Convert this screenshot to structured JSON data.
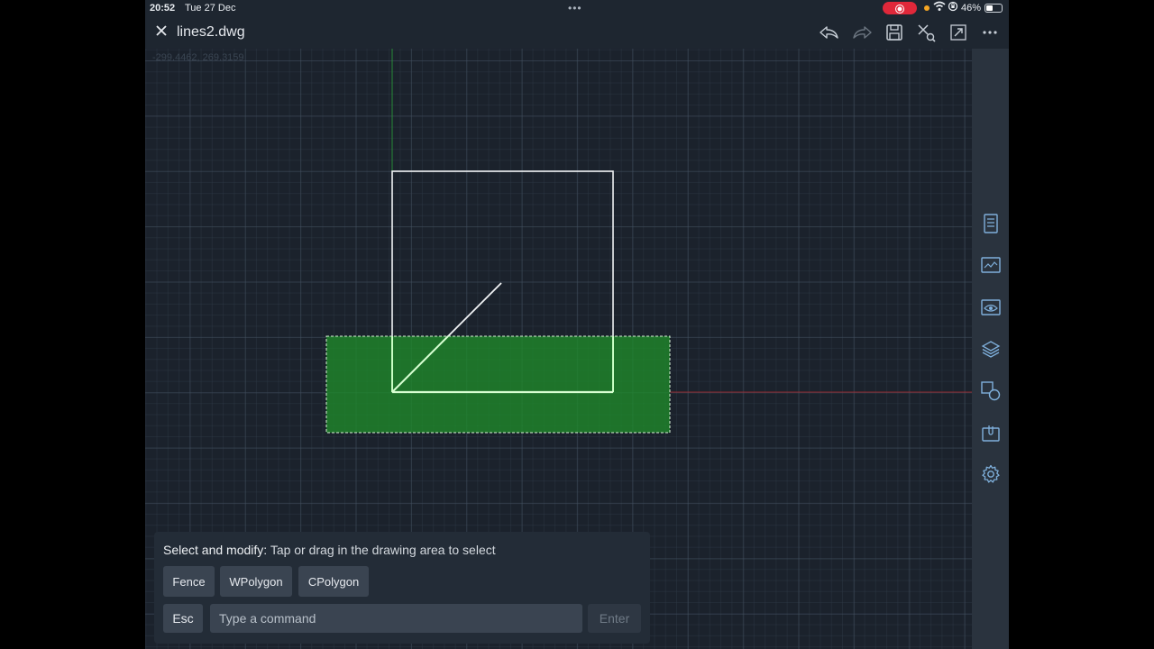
{
  "status_bar": {
    "time": "20:52",
    "date": "Tue 27 Dec",
    "battery": "46%",
    "battery_level": 0.46
  },
  "header": {
    "title": "lines2.dwg",
    "icons": [
      "close-icon",
      "undo-icon",
      "redo-icon",
      "save-icon",
      "trim-icon",
      "fullscreen-icon",
      "more-icon"
    ]
  },
  "canvas": {
    "coordinates": "-299.4462, 269.3159",
    "selection_color": "#1f8a2a",
    "y_axis_color": "#2aa33a",
    "x_axis_color": "#c0262b"
  },
  "right_toolbar": {
    "icons": [
      "properties-icon",
      "layouts-icon",
      "view-icon",
      "layers-icon",
      "blocks-icon",
      "attachments-icon",
      "settings-icon"
    ]
  },
  "command_panel": {
    "prompt_title": "Select and modify:",
    "prompt_text": "Tap or drag in the drawing area to select",
    "options": [
      "Fence",
      "WPolygon",
      "CPolygon"
    ],
    "esc_label": "Esc",
    "input_placeholder": "Type a command",
    "enter_label": "Enter"
  }
}
